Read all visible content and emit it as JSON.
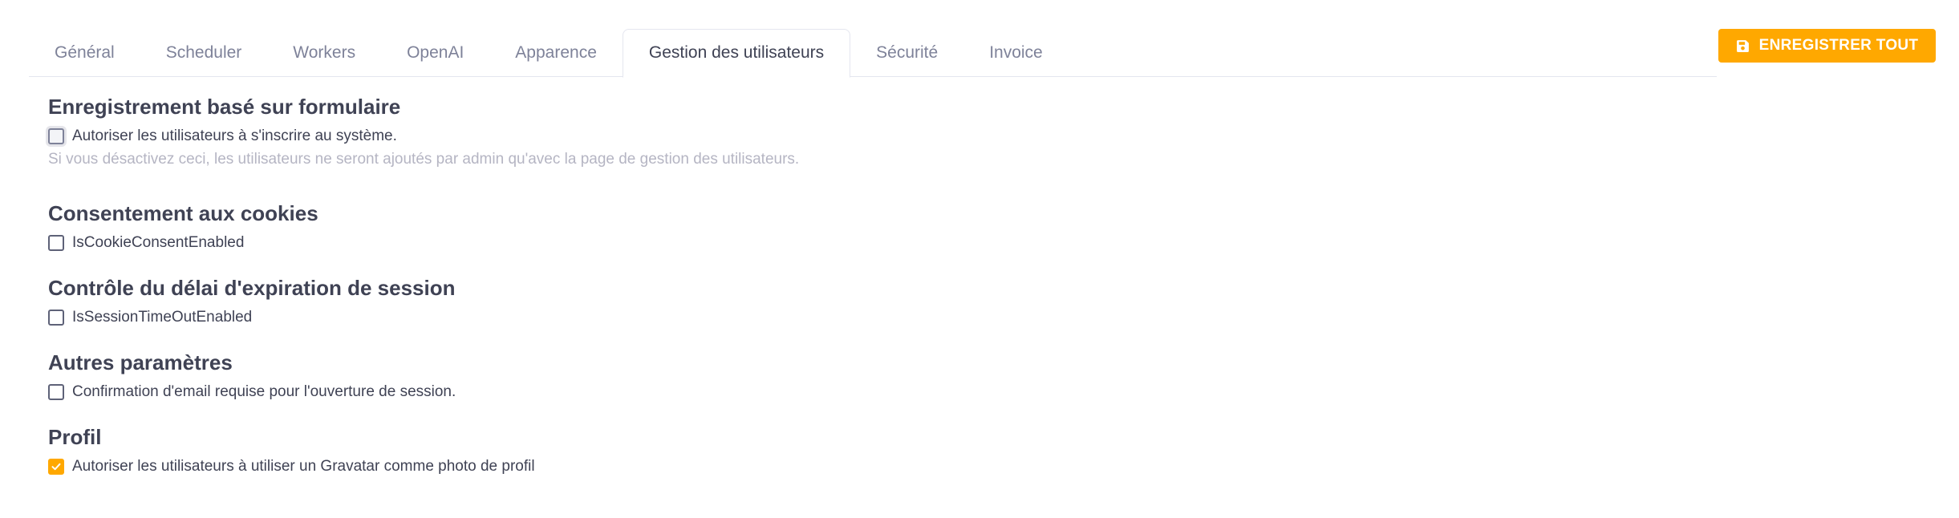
{
  "tabs": [
    {
      "label": "Général",
      "active": false
    },
    {
      "label": "Scheduler",
      "active": false
    },
    {
      "label": "Workers",
      "active": false
    },
    {
      "label": "OpenAI",
      "active": false
    },
    {
      "label": "Apparence",
      "active": false
    },
    {
      "label": "Gestion des utilisateurs",
      "active": true
    },
    {
      "label": "Sécurité",
      "active": false
    },
    {
      "label": "Invoice",
      "active": false
    }
  ],
  "toolbar": {
    "save_label": "ENREGISTRER TOUT",
    "save_icon": "floppy-disk-icon",
    "accent_color": "#ffa800"
  },
  "sections": {
    "form_registration": {
      "title": "Enregistrement basé sur formulaire",
      "checkbox_label": "Autoriser les utilisateurs à s'inscrire au système.",
      "checked": false,
      "help": "Si vous désactivez ceci, les utilisateurs ne seront ajoutés par admin qu'avec la page de gestion des utilisateurs."
    },
    "cookie_consent": {
      "title": "Consentement aux cookies",
      "checkbox_label": "IsCookieConsentEnabled",
      "checked": false
    },
    "session_timeout": {
      "title": "Contrôle du délai d'expiration de session",
      "checkbox_label": "IsSessionTimeOutEnabled",
      "checked": false
    },
    "other_settings": {
      "title": "Autres paramètres",
      "checkbox_label": "Confirmation d'email requise pour l'ouverture de session.",
      "checked": false
    },
    "profile": {
      "title": "Profil",
      "checkbox_label": "Autoriser les utilisateurs à utiliser un Gravatar comme photo de profil",
      "checked": true
    }
  }
}
